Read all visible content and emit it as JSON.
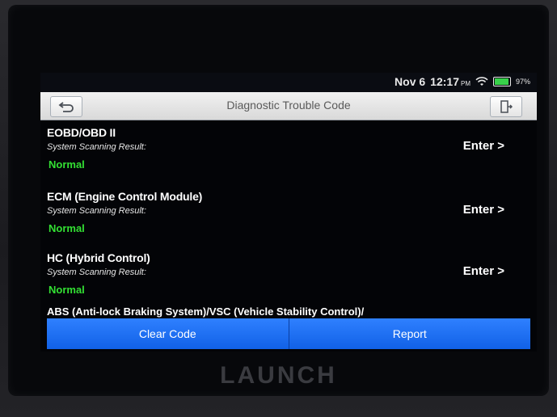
{
  "status_bar": {
    "date": "Nov 6",
    "time": "12:17",
    "ampm": "PM",
    "battery_pct": "97%",
    "battery_level": 0.97
  },
  "title_bar": {
    "title": "Diagnostic Trouble Code",
    "back_icon": "back-arrow-icon",
    "exit_icon": "exit-door-icon"
  },
  "systems": [
    {
      "name": "EOBD/OBD II",
      "label": "System Scanning Result:",
      "status": "Normal",
      "action": "Enter >"
    },
    {
      "name": "ECM (Engine Control Module)",
      "label": "System Scanning Result:",
      "status": "Normal",
      "action": "Enter >"
    },
    {
      "name": "HC (Hybrid Control)",
      "label": "System Scanning Result:",
      "status": "Normal",
      "action": "Enter >"
    }
  ],
  "partial_item": "ABS (Anti-lock Braking System)/VSC (Vehicle Stability Control)/",
  "buttons": {
    "clear": "Clear Code",
    "report": "Report"
  },
  "brand": "LAUNCH",
  "colors": {
    "status_normal": "#33e033",
    "action_blue": "#1f6ff2"
  }
}
